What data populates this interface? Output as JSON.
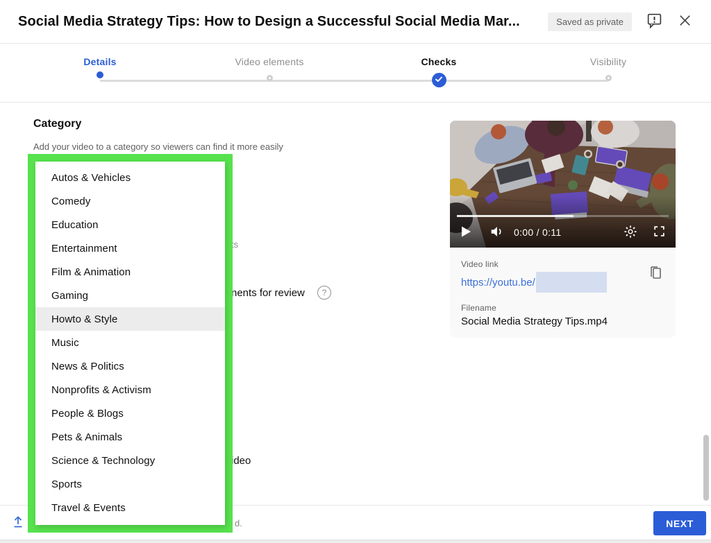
{
  "header": {
    "title": "Social Media Strategy Tips: How to Design a Successful Social Media Mar...",
    "saved_badge": "Saved as private"
  },
  "stepper": {
    "steps": [
      {
        "label": "Details",
        "state": "active"
      },
      {
        "label": "Video elements",
        "state": "idle"
      },
      {
        "label": "Checks",
        "state": "done"
      },
      {
        "label": "Visibility",
        "state": "idle"
      }
    ]
  },
  "main": {
    "section_title": "Category",
    "section_subtitle": "Add your video to a category so viewers can find it more easily",
    "category_list": [
      "Autos & Vehicles",
      "Comedy",
      "Education",
      "Entertainment",
      "Film & Animation",
      "Gaming",
      "Howto & Style",
      "Music",
      "News & Politics",
      "Nonprofits & Activism",
      "People & Blogs",
      "Pets & Animals",
      "Science & Technology",
      "Sports",
      "Travel & Events"
    ],
    "highlighted_item": "Howto & Style",
    "background_fragments": {
      "fragment_top": "ts",
      "fragment_review": "nents for review",
      "fragment_help": "?",
      "fragment_video": "ideo",
      "fragment_bottom": "d."
    }
  },
  "player": {
    "time": "0:00 / 0:11"
  },
  "video_info": {
    "link_label": "Video link",
    "link_url": "https://youtu.be/",
    "filename_label": "Filename",
    "filename": "Social Media Strategy Tips.mp4"
  },
  "footer": {
    "next_label": "NEXT"
  },
  "icons": {
    "feedback-icon": "speech bubble with exclamation",
    "close-icon": "x",
    "check-icon": "checkmark",
    "help-icon": "question mark circle",
    "play-icon": "triangle",
    "volume-icon": "speaker",
    "settings-icon": "gear",
    "fullscreen-icon": "corner brackets",
    "copy-icon": "overlapping pages",
    "upload-icon": "arrow up over line"
  },
  "colors": {
    "accent_blue": "#2b5dd7",
    "link_blue": "#3b6fd9",
    "annotation_green": "#57e24e",
    "badge_bg": "#efefef"
  }
}
